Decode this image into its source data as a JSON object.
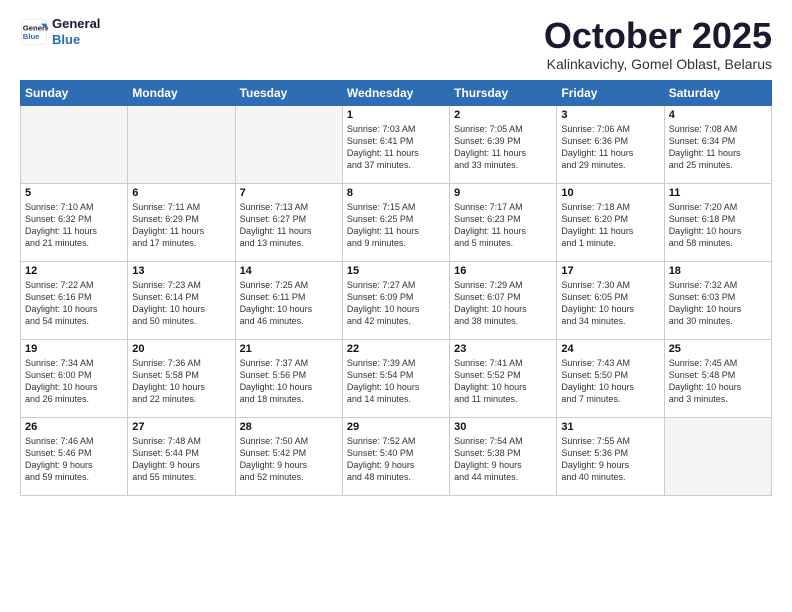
{
  "logo": {
    "line1": "General",
    "line2": "Blue"
  },
  "title": "October 2025",
  "subtitle": "Kalinkavichy, Gomel Oblast, Belarus",
  "weekdays": [
    "Sunday",
    "Monday",
    "Tuesday",
    "Wednesday",
    "Thursday",
    "Friday",
    "Saturday"
  ],
  "weeks": [
    [
      {
        "day": "",
        "info": "",
        "empty": true
      },
      {
        "day": "",
        "info": "",
        "empty": true
      },
      {
        "day": "",
        "info": "",
        "empty": true
      },
      {
        "day": "1",
        "info": "Sunrise: 7:03 AM\nSunset: 6:41 PM\nDaylight: 11 hours\nand 37 minutes."
      },
      {
        "day": "2",
        "info": "Sunrise: 7:05 AM\nSunset: 6:39 PM\nDaylight: 11 hours\nand 33 minutes."
      },
      {
        "day": "3",
        "info": "Sunrise: 7:06 AM\nSunset: 6:36 PM\nDaylight: 11 hours\nand 29 minutes."
      },
      {
        "day": "4",
        "info": "Sunrise: 7:08 AM\nSunset: 6:34 PM\nDaylight: 11 hours\nand 25 minutes."
      }
    ],
    [
      {
        "day": "5",
        "info": "Sunrise: 7:10 AM\nSunset: 6:32 PM\nDaylight: 11 hours\nand 21 minutes."
      },
      {
        "day": "6",
        "info": "Sunrise: 7:11 AM\nSunset: 6:29 PM\nDaylight: 11 hours\nand 17 minutes."
      },
      {
        "day": "7",
        "info": "Sunrise: 7:13 AM\nSunset: 6:27 PM\nDaylight: 11 hours\nand 13 minutes."
      },
      {
        "day": "8",
        "info": "Sunrise: 7:15 AM\nSunset: 6:25 PM\nDaylight: 11 hours\nand 9 minutes."
      },
      {
        "day": "9",
        "info": "Sunrise: 7:17 AM\nSunset: 6:23 PM\nDaylight: 11 hours\nand 5 minutes."
      },
      {
        "day": "10",
        "info": "Sunrise: 7:18 AM\nSunset: 6:20 PM\nDaylight: 11 hours\nand 1 minute."
      },
      {
        "day": "11",
        "info": "Sunrise: 7:20 AM\nSunset: 6:18 PM\nDaylight: 10 hours\nand 58 minutes."
      }
    ],
    [
      {
        "day": "12",
        "info": "Sunrise: 7:22 AM\nSunset: 6:16 PM\nDaylight: 10 hours\nand 54 minutes."
      },
      {
        "day": "13",
        "info": "Sunrise: 7:23 AM\nSunset: 6:14 PM\nDaylight: 10 hours\nand 50 minutes."
      },
      {
        "day": "14",
        "info": "Sunrise: 7:25 AM\nSunset: 6:11 PM\nDaylight: 10 hours\nand 46 minutes."
      },
      {
        "day": "15",
        "info": "Sunrise: 7:27 AM\nSunset: 6:09 PM\nDaylight: 10 hours\nand 42 minutes."
      },
      {
        "day": "16",
        "info": "Sunrise: 7:29 AM\nSunset: 6:07 PM\nDaylight: 10 hours\nand 38 minutes."
      },
      {
        "day": "17",
        "info": "Sunrise: 7:30 AM\nSunset: 6:05 PM\nDaylight: 10 hours\nand 34 minutes."
      },
      {
        "day": "18",
        "info": "Sunrise: 7:32 AM\nSunset: 6:03 PM\nDaylight: 10 hours\nand 30 minutes."
      }
    ],
    [
      {
        "day": "19",
        "info": "Sunrise: 7:34 AM\nSunset: 6:00 PM\nDaylight: 10 hours\nand 26 minutes."
      },
      {
        "day": "20",
        "info": "Sunrise: 7:36 AM\nSunset: 5:58 PM\nDaylight: 10 hours\nand 22 minutes."
      },
      {
        "day": "21",
        "info": "Sunrise: 7:37 AM\nSunset: 5:56 PM\nDaylight: 10 hours\nand 18 minutes."
      },
      {
        "day": "22",
        "info": "Sunrise: 7:39 AM\nSunset: 5:54 PM\nDaylight: 10 hours\nand 14 minutes."
      },
      {
        "day": "23",
        "info": "Sunrise: 7:41 AM\nSunset: 5:52 PM\nDaylight: 10 hours\nand 11 minutes."
      },
      {
        "day": "24",
        "info": "Sunrise: 7:43 AM\nSunset: 5:50 PM\nDaylight: 10 hours\nand 7 minutes."
      },
      {
        "day": "25",
        "info": "Sunrise: 7:45 AM\nSunset: 5:48 PM\nDaylight: 10 hours\nand 3 minutes."
      }
    ],
    [
      {
        "day": "26",
        "info": "Sunrise: 7:46 AM\nSunset: 5:46 PM\nDaylight: 9 hours\nand 59 minutes."
      },
      {
        "day": "27",
        "info": "Sunrise: 7:48 AM\nSunset: 5:44 PM\nDaylight: 9 hours\nand 55 minutes."
      },
      {
        "day": "28",
        "info": "Sunrise: 7:50 AM\nSunset: 5:42 PM\nDaylight: 9 hours\nand 52 minutes."
      },
      {
        "day": "29",
        "info": "Sunrise: 7:52 AM\nSunset: 5:40 PM\nDaylight: 9 hours\nand 48 minutes."
      },
      {
        "day": "30",
        "info": "Sunrise: 7:54 AM\nSunset: 5:38 PM\nDaylight: 9 hours\nand 44 minutes."
      },
      {
        "day": "31",
        "info": "Sunrise: 7:55 AM\nSunset: 5:36 PM\nDaylight: 9 hours\nand 40 minutes."
      },
      {
        "day": "",
        "info": "",
        "empty": true
      }
    ]
  ]
}
